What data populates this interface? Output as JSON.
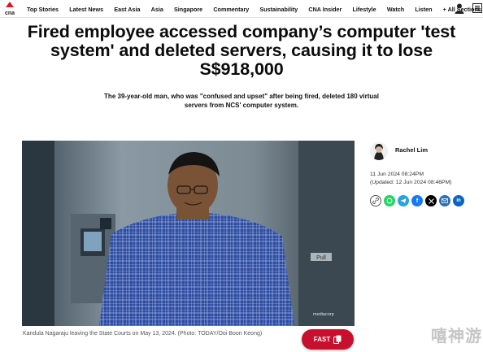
{
  "brand": {
    "logo_text": "cna"
  },
  "nav": {
    "items": [
      "Top Stories",
      "Latest News",
      "East Asia",
      "Asia",
      "Singapore",
      "Commentary",
      "Sustainability",
      "CNA Insider",
      "Lifestyle",
      "Watch",
      "Listen",
      "+ All Sections"
    ]
  },
  "article": {
    "headline": "Fired employee accessed company’s computer 'test system' and deleted servers, causing it to lose S$918,000",
    "summary": "The 39-year-old man, who was \"confused and upset\" after being fired, deleted 180 virtual servers from NCS' computer system.",
    "caption": "Kandula Nagaraju leaving the State Courts on May 13, 2024. (Photo: TODAY/Ooi Boon Keong)",
    "photo_credit_mark": "mediacorp",
    "door_sign": "Pull"
  },
  "author": {
    "name": "Rachel Lim",
    "published": "11 Jun 2024 08:24PM",
    "updated": "(Updated: 12 Jun 2024 08:46PM)"
  },
  "share": {
    "icons": [
      "link-icon",
      "whatsapp-icon",
      "telegram-icon",
      "facebook-icon",
      "x-icon",
      "email-icon",
      "linkedin-icon"
    ],
    "colors": {
      "link": "#ffffff",
      "whatsapp": "#25d366",
      "telegram": "#2aa3dc",
      "facebook": "#1877f2",
      "x": "#000000",
      "email": "#2f6fb0",
      "linkedin": "#0a66c2"
    }
  },
  "fast_button": {
    "label": "FAST"
  },
  "watermark": "嘻神游",
  "colors": {
    "accent": "#c8102e",
    "logo_red": "#d71920"
  }
}
